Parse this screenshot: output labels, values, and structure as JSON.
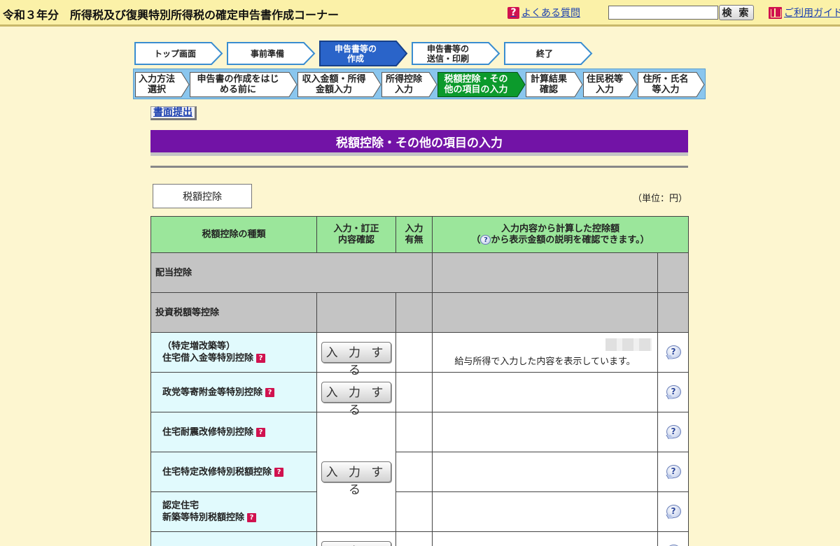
{
  "header": {
    "title": "令和３年分　所得税及び復興特別所得税の確定申告書作成コーナー",
    "faq_label": "よくある質問",
    "search_placeholder": "",
    "search_button": "検 索",
    "guide_label": "ご利用ガイド"
  },
  "steps": [
    {
      "label_line1": "トップ画面",
      "label_line2": "",
      "active": false
    },
    {
      "label_line1": "事前準備",
      "label_line2": "",
      "active": false
    },
    {
      "label_line1": "申告書等の",
      "label_line2": "作成",
      "active": true
    },
    {
      "label_line1": "申告書等の",
      "label_line2": "送信・印刷",
      "active": false
    },
    {
      "label_line1": "終了",
      "label_line2": "",
      "active": false
    }
  ],
  "substeps": [
    {
      "line1": "入力方法",
      "line2": "選択",
      "active": false
    },
    {
      "line1": "申告書の作成をはじ",
      "line2": "める前に",
      "active": false
    },
    {
      "line1": "収入金額・所得",
      "line2": "金額入力",
      "active": false
    },
    {
      "line1": "所得控除",
      "line2": "入力",
      "active": false
    },
    {
      "line1": "税額控除・その",
      "line2": "他の項目の入力",
      "active": true
    },
    {
      "line1": "計算結果",
      "line2": "確認",
      "active": false
    },
    {
      "line1": "住民税等",
      "line2": "入力",
      "active": false
    },
    {
      "line1": "住所・氏名",
      "line2": "等入力",
      "active": false
    }
  ],
  "submit_paper_label": "書面提出",
  "section_title": "税額控除・その他の項目の入力",
  "tab_label": "税額控除",
  "unit_label": "（単位：円）",
  "table": {
    "headers": {
      "type": "税額控除の種類",
      "input_line1": "入力・訂正",
      "input_line2": "内容確認",
      "has_line1": "入力",
      "has_line2": "有無",
      "amount_line1": "入力内容から計算した控除額",
      "amount_line2_pre": "（",
      "amount_line2_post": "から表示金額の説明を確認できます。）"
    },
    "rows": {
      "dividend": "配当控除",
      "investment": "投資税額等控除",
      "housing_line1": "（特定増改築等）",
      "housing_line2": "住宅借入金等特別控除",
      "housing_note": "給与所得で入力した内容を表示しています。",
      "political": "政党等寄附金等特別控除",
      "quake": "住宅耐震改修特別控除",
      "renovation": "住宅特定改修特別税額控除",
      "certified_line1": "認定住宅",
      "certified_line2": "新築等特別税額控除",
      "last_partial": "",
      "input_button": "入 力 す る"
    }
  }
}
